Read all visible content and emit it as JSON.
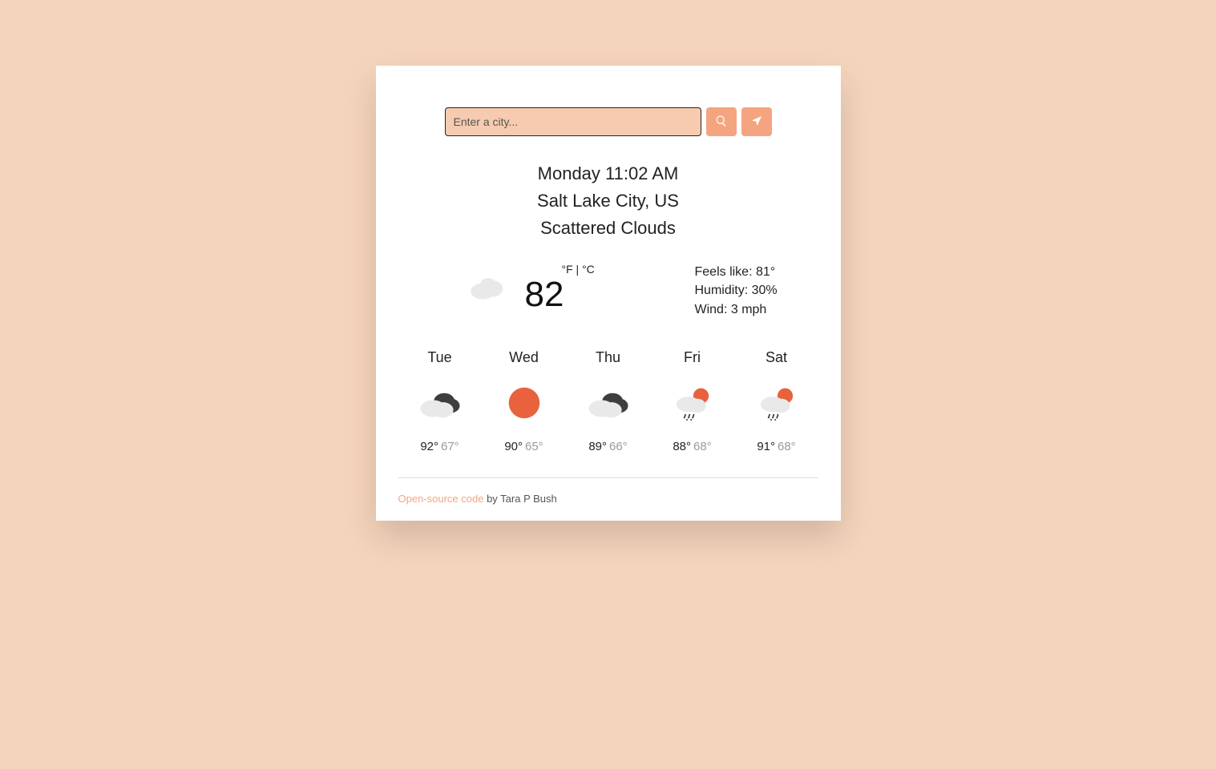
{
  "search": {
    "placeholder": "Enter a city..."
  },
  "header": {
    "datetime": "Monday 11:02 AM",
    "location": "Salt Lake City, US",
    "condition": "Scattered Clouds"
  },
  "units": {
    "f": "°F",
    "sep": " | ",
    "c": "°C"
  },
  "current": {
    "temp": "82",
    "feels_label": "Feels like: ",
    "feels_value": "81°",
    "humidity_label": "Humidity: ",
    "humidity_value": "30%",
    "wind_label": "Wind: ",
    "wind_value": "3 mph"
  },
  "forecast": [
    {
      "day": "Tue",
      "hi": "92°",
      "lo": "67°",
      "icon": "cloudy"
    },
    {
      "day": "Wed",
      "hi": "90°",
      "lo": "65°",
      "icon": "sunny"
    },
    {
      "day": "Thu",
      "hi": "89°",
      "lo": "66°",
      "icon": "cloudy"
    },
    {
      "day": "Fri",
      "hi": "88°",
      "lo": "68°",
      "icon": "rain-sun"
    },
    {
      "day": "Sat",
      "hi": "91°",
      "lo": "68°",
      "icon": "rain-sun"
    }
  ],
  "footer": {
    "link": "Open-source code",
    "by": " by Tara P Bush"
  }
}
